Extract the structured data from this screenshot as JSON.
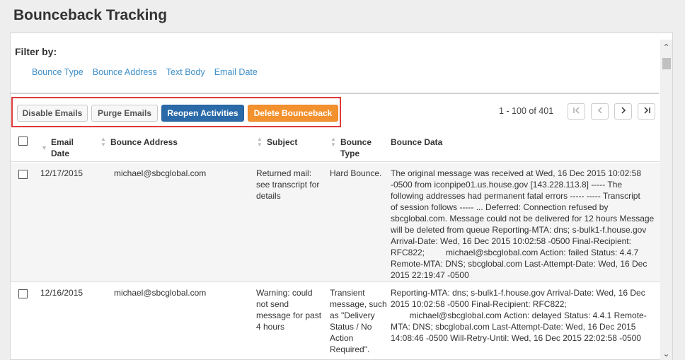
{
  "page_title": "Bounceback Tracking",
  "filter": {
    "label": "Filter by:",
    "links": [
      "Bounce Type",
      "Bounce Address",
      "Text Body",
      "Email Date"
    ]
  },
  "toolbar": {
    "disable_label": "Disable Emails",
    "purge_label": "Purge Emails",
    "reopen_label": "Reopen Activities",
    "delete_label": "Delete Bounceback"
  },
  "pager": {
    "range_text": "1 - 100 of 401",
    "first_icon": "first-page-icon",
    "prev_icon": "prev-page-icon",
    "next_icon": "next-page-icon",
    "last_icon": "last-page-icon"
  },
  "table": {
    "headers": {
      "email_date_line1": "Email",
      "email_date_line2": "Date",
      "bounce_address": "Bounce Address",
      "subject": "Subject",
      "bounce_type_line1": "Bounce",
      "bounce_type_line2": "Type",
      "bounce_data": "Bounce Data"
    },
    "rows": [
      {
        "date": "12/17/2015",
        "address": "michael@sbcglobal.com",
        "subject": [
          "Returned mail:",
          "see transcript for",
          "details"
        ],
        "type": [
          "Hard Bounce."
        ],
        "data": [
          "The original message was received at Wed, 16 Dec 2015 10:02:58",
          "-0500 from iconpipe01.us.house.gov [143.228.113.8] ----- The",
          "following addresses had permanent fatal errors ----- ----- Transcript",
          "of session follows ----- ... Deferred: Connection refused by",
          "sbcglobal.com. Message could not be delivered for 12 hours Message",
          "will be deleted from queue Reporting-MTA: dns; s-bulk1-f.house.gov",
          "Arrival-Date: Wed, 16 Dec 2015 10:02:58 -0500 Final-Recipient:",
          "RFC822;         michael@sbcglobal.com Action: failed Status: 4.4.7",
          "Remote-MTA: DNS; sbcglobal.com Last-Attempt-Date: Wed, 16 Dec",
          "2015 22:19:47 -0500"
        ]
      },
      {
        "date": "12/16/2015",
        "address": "michael@sbcglobal.com",
        "subject": [
          "Warning: could",
          "not send",
          "message for past",
          "4 hours"
        ],
        "type": [
          "Transient",
          "message, such",
          "as \"Delivery",
          "Status / No",
          "Action",
          "Required\"."
        ],
        "data": [
          "Reporting-MTA: dns; s-bulk1-f.house.gov Arrival-Date: Wed, 16 Dec",
          "2015 10:02:58 -0500 Final-Recipient: RFC822;",
          "        michael@sbcglobal.com Action: delayed Status: 4.4.1 Remote-",
          "MTA: DNS; sbcglobal.com Last-Attempt-Date: Wed, 16 Dec 2015",
          "14:08:46 -0500 Will-Retry-Until: Wed, 16 Dec 2015 22:02:58 -0500"
        ]
      }
    ]
  },
  "colors": {
    "reopen_button": "#2a6aa8",
    "delete_button": "#f4912f",
    "highlight_border": "#e03a3a",
    "link": "#3d8ec9"
  }
}
